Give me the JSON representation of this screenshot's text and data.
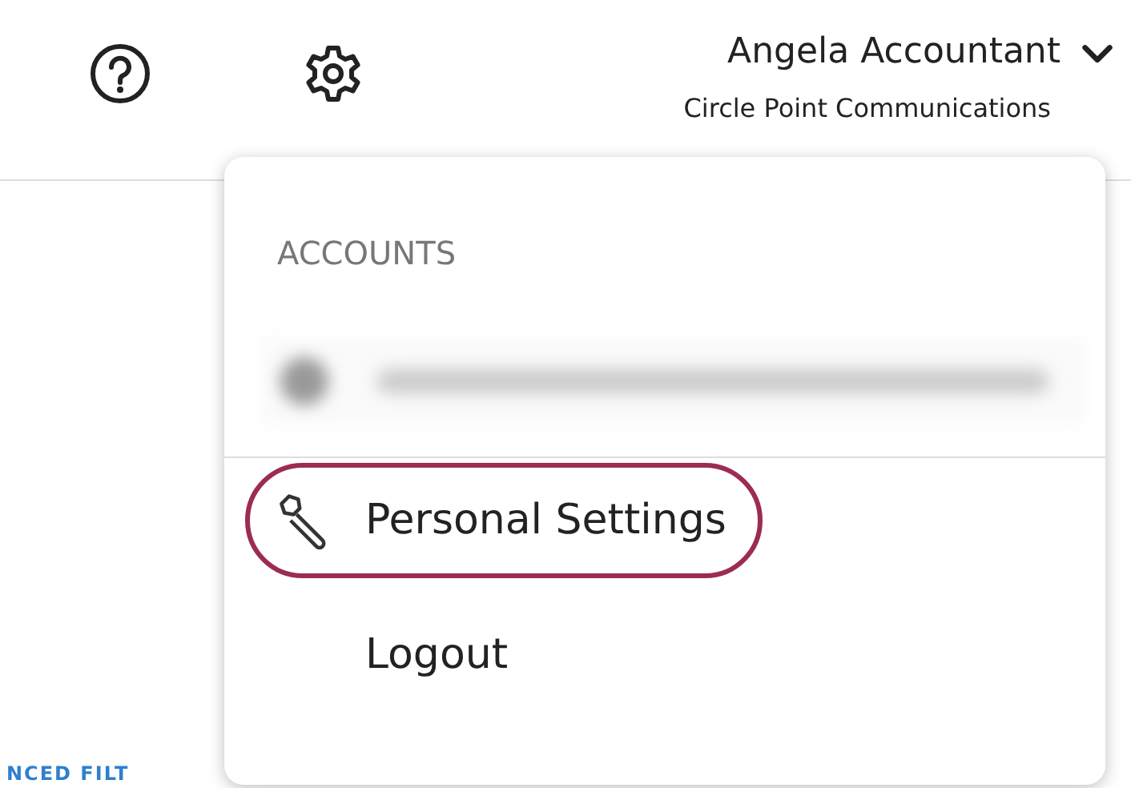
{
  "header": {
    "user_name": "Angela Accountant",
    "company": "Circle Point Communications",
    "expanded": true
  },
  "page": {
    "link_fragment": "NCED FILT"
  },
  "menu": {
    "section_title": "ACCOUNTS",
    "accounts": [
      {
        "kind": "redacted"
      }
    ],
    "items": [
      {
        "kind": "wrench",
        "label": "Personal Settings",
        "selected": true
      },
      {
        "kind": "plain",
        "label": "Logout",
        "selected": false
      }
    ]
  }
}
